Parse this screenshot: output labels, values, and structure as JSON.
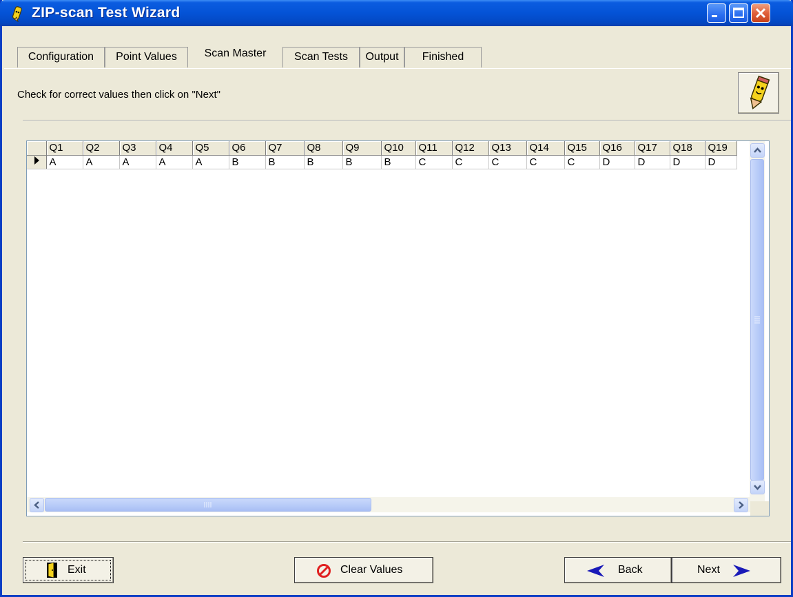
{
  "window": {
    "title": "ZIP-scan Test Wizard"
  },
  "tabs": [
    {
      "label": "Configuration"
    },
    {
      "label": "Point Values"
    },
    {
      "label": "Scan Master"
    },
    {
      "label": "Scan Tests"
    },
    {
      "label": "Output"
    },
    {
      "label": "Finished"
    }
  ],
  "active_tab": "Scan Master",
  "instruction": "Check for correct values then click on \"Next\"",
  "grid": {
    "columns": [
      "Q1",
      "Q2",
      "Q3",
      "Q4",
      "Q5",
      "Q6",
      "Q7",
      "Q8",
      "Q9",
      "Q10",
      "Q11",
      "Q12",
      "Q13",
      "Q14",
      "Q15",
      "Q16",
      "Q17",
      "Q18",
      "Q19"
    ],
    "rows": [
      [
        "A",
        "A",
        "A",
        "A",
        "A",
        "B",
        "B",
        "B",
        "B",
        "B",
        "C",
        "C",
        "C",
        "C",
        "C",
        "D",
        "D",
        "D",
        "D"
      ]
    ]
  },
  "buttons": {
    "exit": "Exit",
    "clear": "Clear Values",
    "back": "Back",
    "next": "Next"
  },
  "icons": {
    "app": "pencil-mascot-icon",
    "clear": "no-entry-icon",
    "back": "arrow-left-icon",
    "next": "arrow-right-icon",
    "exit": "door-icon"
  },
  "colors": {
    "titlebar": "#0453d6",
    "face": "#ece9d8",
    "arrow": "#1a1ab8",
    "clear_icon": "#e02020"
  }
}
